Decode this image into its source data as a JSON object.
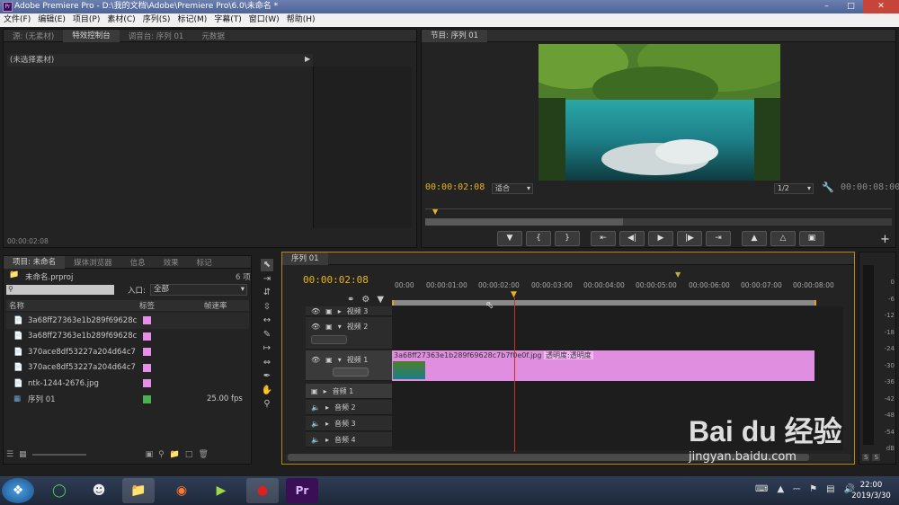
{
  "window": {
    "title": "Adobe Premiere Pro - D:\\我的文档\\Adobe\\Premiere Pro\\6.0\\未命名 *",
    "app_icon": "Pr"
  },
  "menu": [
    "文件(F)",
    "编辑(E)",
    "项目(P)",
    "素材(C)",
    "序列(S)",
    "标记(M)",
    "字幕(T)",
    "窗口(W)",
    "帮助(H)"
  ],
  "source_panel": {
    "tabs": [
      "源: (无素材)",
      "特效控制台",
      "调音台: 序列 01",
      "元数据"
    ],
    "active_tab": 1,
    "no_clip_label": "(未选择素材)",
    "timecode": "00:00:02:08"
  },
  "program_monitor": {
    "tab": "节目: 序列 01",
    "current_time": "00:00:02:08",
    "fit": "适合",
    "resolution": "1/2",
    "duration": "00:00:08:00"
  },
  "project_panel": {
    "tabs": [
      "项目: 未命名",
      "媒体浏览器",
      "信息",
      "效果",
      "标记"
    ],
    "project_name": "未命名.prproj",
    "item_count": "6 项",
    "search_placeholder": "",
    "in_label": "入口:",
    "in_value": "全部",
    "columns": [
      "名称",
      "标签",
      "帧速率"
    ],
    "items": [
      {
        "name": "3a68ff27363e1b289f69628c",
        "label_color": "#e58fe6",
        "fps": ""
      },
      {
        "name": "3a68ff27363e1b289f69628c",
        "label_color": "#e58fe6",
        "fps": ""
      },
      {
        "name": "370ace8df53227a204d64c7",
        "label_color": "#e58fe6",
        "fps": ""
      },
      {
        "name": "370ace8df53227a204d64c7",
        "label_color": "#e58fe6",
        "fps": ""
      },
      {
        "name": "ntk-1244-2676.jpg",
        "label_color": "#e58fe6",
        "fps": ""
      },
      {
        "name": "序列 01",
        "label_color": "#4caf50",
        "fps": "25.00 fps"
      }
    ]
  },
  "timeline": {
    "tab": "序列 01",
    "timecode": "00:00:02:08",
    "ruler_labels": [
      "00:00",
      "00:00:01:00",
      "00:00:02:00",
      "00:00:03:00",
      "00:00:04:00",
      "00:00:05:00",
      "00:00:06:00",
      "00:00:07:00",
      "00:00:08:00"
    ],
    "tracks": [
      {
        "name": "视频 3",
        "kind": "video"
      },
      {
        "name": "视频 2",
        "kind": "video"
      },
      {
        "name": "视频 1",
        "kind": "video"
      },
      {
        "name": "音频 1",
        "kind": "audio"
      },
      {
        "name": "音频 2",
        "kind": "audio"
      },
      {
        "name": "音频 3",
        "kind": "audio"
      },
      {
        "name": "音频 4",
        "kind": "audio"
      }
    ],
    "clip": {
      "name": "3a68ff27363e1b289f69628c7b7f0e0f.jpg",
      "effect": "透明度:透明度",
      "color": "#e08fe0"
    }
  },
  "audio_meter": {
    "labels": [
      "0",
      "-6",
      "-12",
      "-18",
      "-24",
      "-30",
      "-36",
      "-42",
      "-48",
      "-54",
      "dB"
    ],
    "solo": [
      "S",
      "S"
    ]
  },
  "taskbar": {
    "time": "22:00",
    "date": "2019/3/30"
  },
  "watermark": {
    "text": "Bai du 经验",
    "url": "jingyan.baidu.com"
  }
}
